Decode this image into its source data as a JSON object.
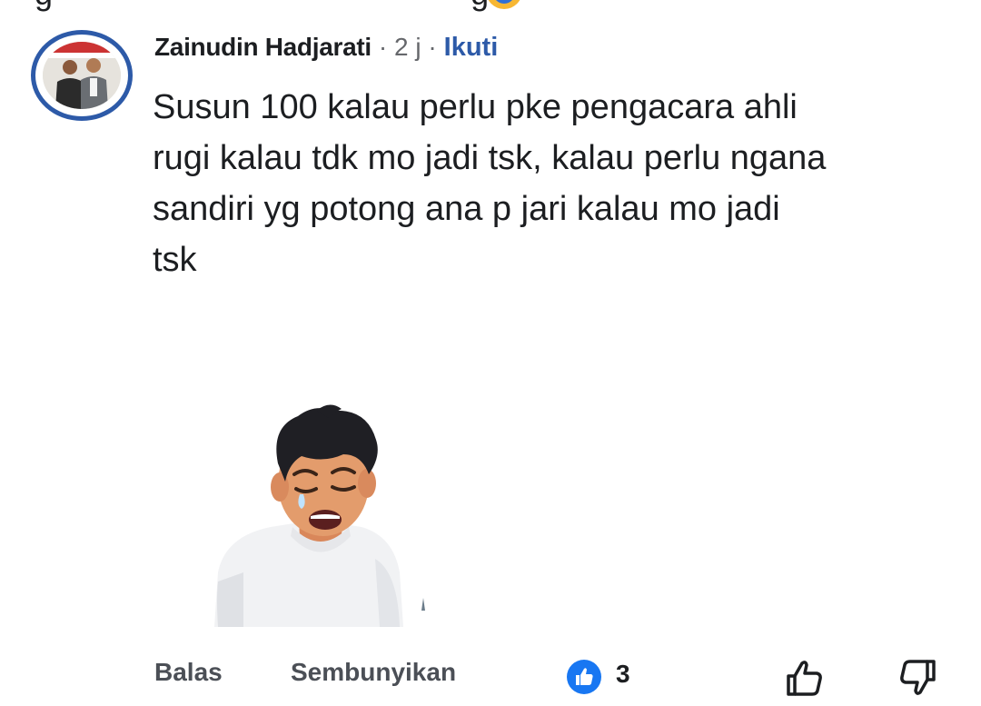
{
  "comment": {
    "author": "Zainudin Hadjarati",
    "time": "· 2 j ·",
    "follow_label": "Ikuti",
    "text_lines": [
      "Susun 100 kalau perlu pke pengacara ahli",
      "rugi kalau tdk mo jadi tsk, kalau perlu ngana",
      "sandiri yg potong ana p jari kalau mo jadi",
      "tsk"
    ],
    "sticker": "crying-avatar-sticker"
  },
  "actions": {
    "reply_label": "Balas",
    "hide_label": "Sembunyikan",
    "reaction_count": "3",
    "reaction_icon": "like-reaction-icon"
  },
  "colors": {
    "link_blue": "#2d5aa8",
    "reaction_blue": "#1877f2",
    "secondary_text": "#65676b"
  }
}
